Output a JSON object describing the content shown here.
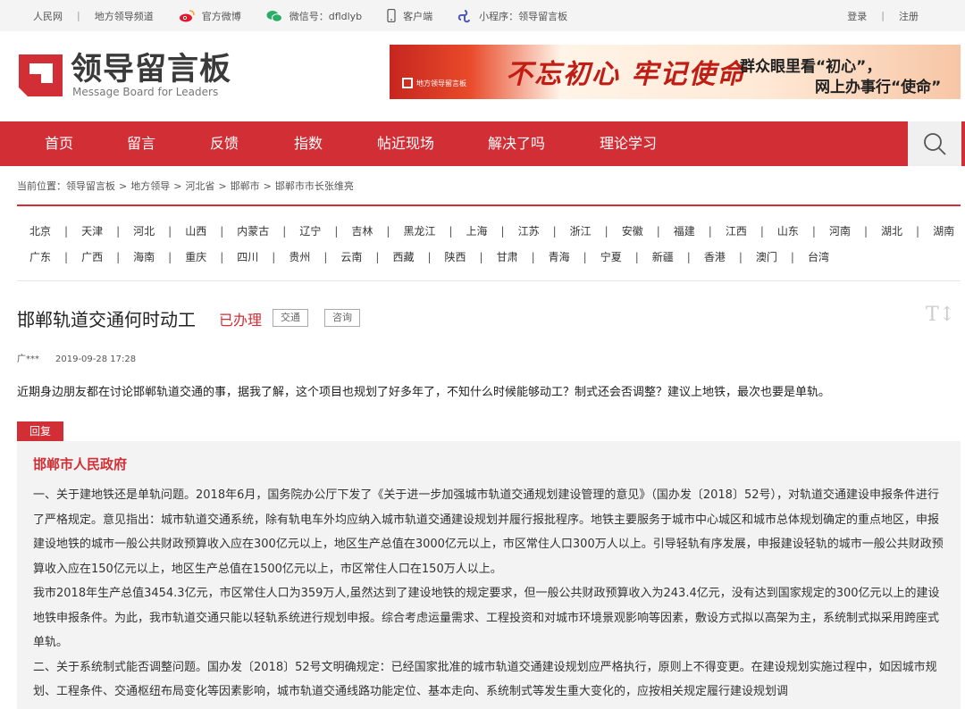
{
  "topbar": {
    "site": "人民网",
    "channel": "地方领导频道",
    "weibo": "官方微博",
    "wechat": "微信号：dfldlyb",
    "client": "客户端",
    "miniprogram": "小程序：领导留言板",
    "login": "登录",
    "register": "注册",
    "separator": "|"
  },
  "logo": {
    "title": "领导留言板",
    "subtitle": "Message Board for Leaders"
  },
  "banner": {
    "badge": "地方领导留言板",
    "slogan_script": "不忘初心 牢记使命",
    "line1": "群众眼里看“初心”，",
    "line2": "网上办事行“使命”"
  },
  "nav": {
    "items": [
      "首页",
      "留言",
      "反馈",
      "指数",
      "帖近现场",
      "解决了吗",
      "理论学习"
    ]
  },
  "breadcrumb": {
    "prefix": "当前位置：",
    "items": [
      "领导留言板",
      "地方领导",
      "河北省",
      "邯郸市",
      "邯郸市市长张维亮"
    ]
  },
  "regions": {
    "row1": [
      "北京",
      "天津",
      "河北",
      "山西",
      "内蒙古",
      "辽宁",
      "吉林",
      "黑龙江",
      "上海",
      "江苏",
      "浙江",
      "安徽",
      "福建",
      "江西",
      "山东",
      "河南",
      "湖北",
      "湖南"
    ],
    "row2": [
      "广东",
      "广西",
      "海南",
      "重庆",
      "四川",
      "贵州",
      "云南",
      "西藏",
      "陕西",
      "甘肃",
      "青海",
      "宁夏",
      "新疆",
      "香港",
      "澳门",
      "台湾"
    ]
  },
  "post": {
    "title": "邯郸轨道交通何时动工",
    "status": "已办理",
    "tags": [
      "交通",
      "咨询"
    ],
    "font_toggle": "T↕",
    "author": "广***",
    "date": "2019-09-28 17:28",
    "body": "近期身边朋友都在讨论邯郸轨道交通的事，据我了解，这个项目也规划了好多年了，不知什么时候能够动工？制式还会否调整？建议上地铁，最次也要是单轨。"
  },
  "reply": {
    "label": "回复",
    "org": "邯郸市人民政府",
    "paragraphs": [
      "一、关于建地铁还是单轨问题。2018年6月，国务院办公厅下发了《关于进一步加强城市轨道交通规划建设管理的意见》（国办发〔2018〕52号），对轨道交通建设申报条件进行了严格规定。意见指出：城市轨道交通系统，除有轨电车外均应纳入城市轨道交通建设规划并履行报批程序。地铁主要服务于城市中心城区和城市总体规划确定的重点地区，申报建设地铁的城市一般公共财政预算收入应在300亿元以上，地区生产总值在3000亿元以上，市区常住人口300万人以上。引导轻轨有序发展，申报建设轻轨的城市一般公共财政预算收入应在150亿元以上，地区生产总值在1500亿元以上，市区常住人口在150万人以上。",
      "我市2018年生产总值3454.3亿元，市区常住人口为359万人,虽然达到了建设地铁的规定要求，但一般公共财政预算收入为243.4亿元，没有达到国家规定的300亿元以上的建设地铁申报条件。为此，我市轨道交通只能以轻轨系统进行规划申报。综合考虑运量需求、工程投资和对城市环境景观影响等因素，敷设方式拟以高架为主，系统制式拟采用跨座式单轨。",
      "二、关于系统制式能否调整问题。国办发〔2018〕52号文明确规定：已经国家批准的城市轨道交通建设规划应严格执行，原则上不得变更。在建设规划实施过程中，如因城市规划、工程条件、交通枢纽布局变化等因素影响，城市轨道交通线路功能定位、基本走向、系统制式等发生重大变化的，应按相关规定履行建设规划调"
    ]
  },
  "colors": {
    "brand_red": "#d22e35",
    "topbar_bg": "#f4f4f4",
    "reply_bg": "#f3f3f3"
  }
}
